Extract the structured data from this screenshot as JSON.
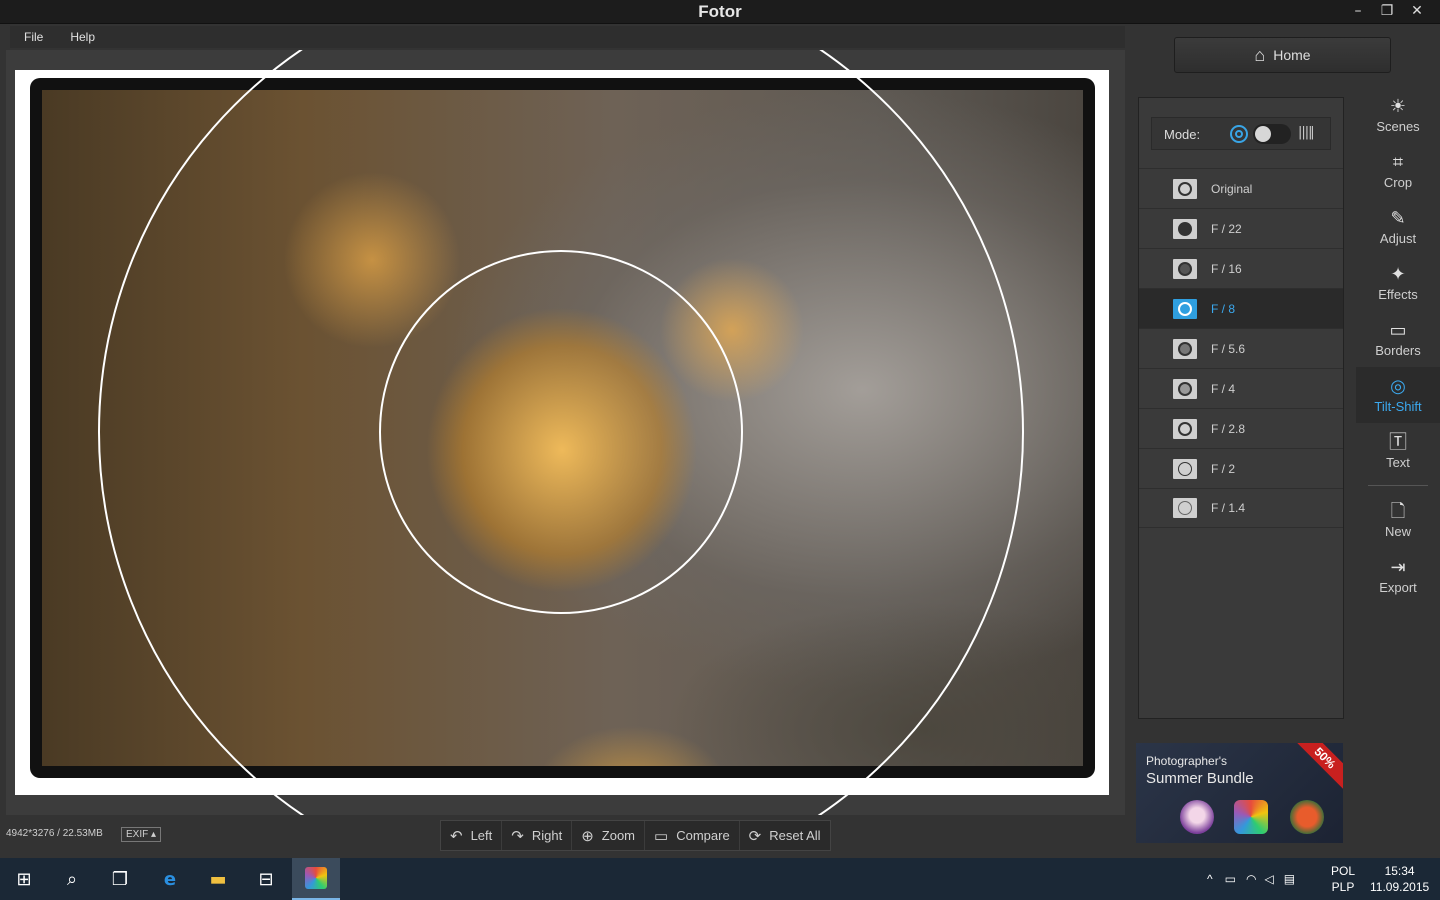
{
  "window": {
    "title": "Fotor",
    "minimize": "–",
    "restore": "❐",
    "close": "✕"
  },
  "menu": {
    "items": [
      "File",
      "Help"
    ]
  },
  "canvas": {
    "image_info": "4942*3276 / 22.53MB",
    "exif_label": "EXIF ▴"
  },
  "bottom_toolbar": {
    "left": "Left",
    "right": "Right",
    "zoom": "Zoom",
    "compare": "Compare",
    "reset": "Reset All"
  },
  "home": {
    "label": "Home"
  },
  "mode": {
    "label": "Mode:"
  },
  "apertures": {
    "items": [
      "Original",
      "F / 22",
      "F / 16",
      "F / 8",
      "F / 5.6",
      "F / 4",
      "F / 2.8",
      "F / 2",
      "F / 1.4"
    ],
    "selected": "F / 8"
  },
  "ad": {
    "line1": "Photographer's",
    "line2": "Summer Bundle",
    "badge": "50%"
  },
  "tools": {
    "scenes": "Scenes",
    "crop": "Crop",
    "adjust": "Adjust",
    "effects": "Effects",
    "borders": "Borders",
    "tiltshift": "Tilt-Shift",
    "text": "Text",
    "new": "New",
    "export": "Export",
    "active": "Tilt-Shift"
  },
  "taskbar": {
    "lang_top": "POL",
    "lang_bottom": "PLP",
    "time": "15:34",
    "date": "11.09.2015"
  },
  "colors": {
    "accent": "#3ba9ef",
    "taskbar": "#1b2836",
    "panel": "#3a3a3a"
  }
}
